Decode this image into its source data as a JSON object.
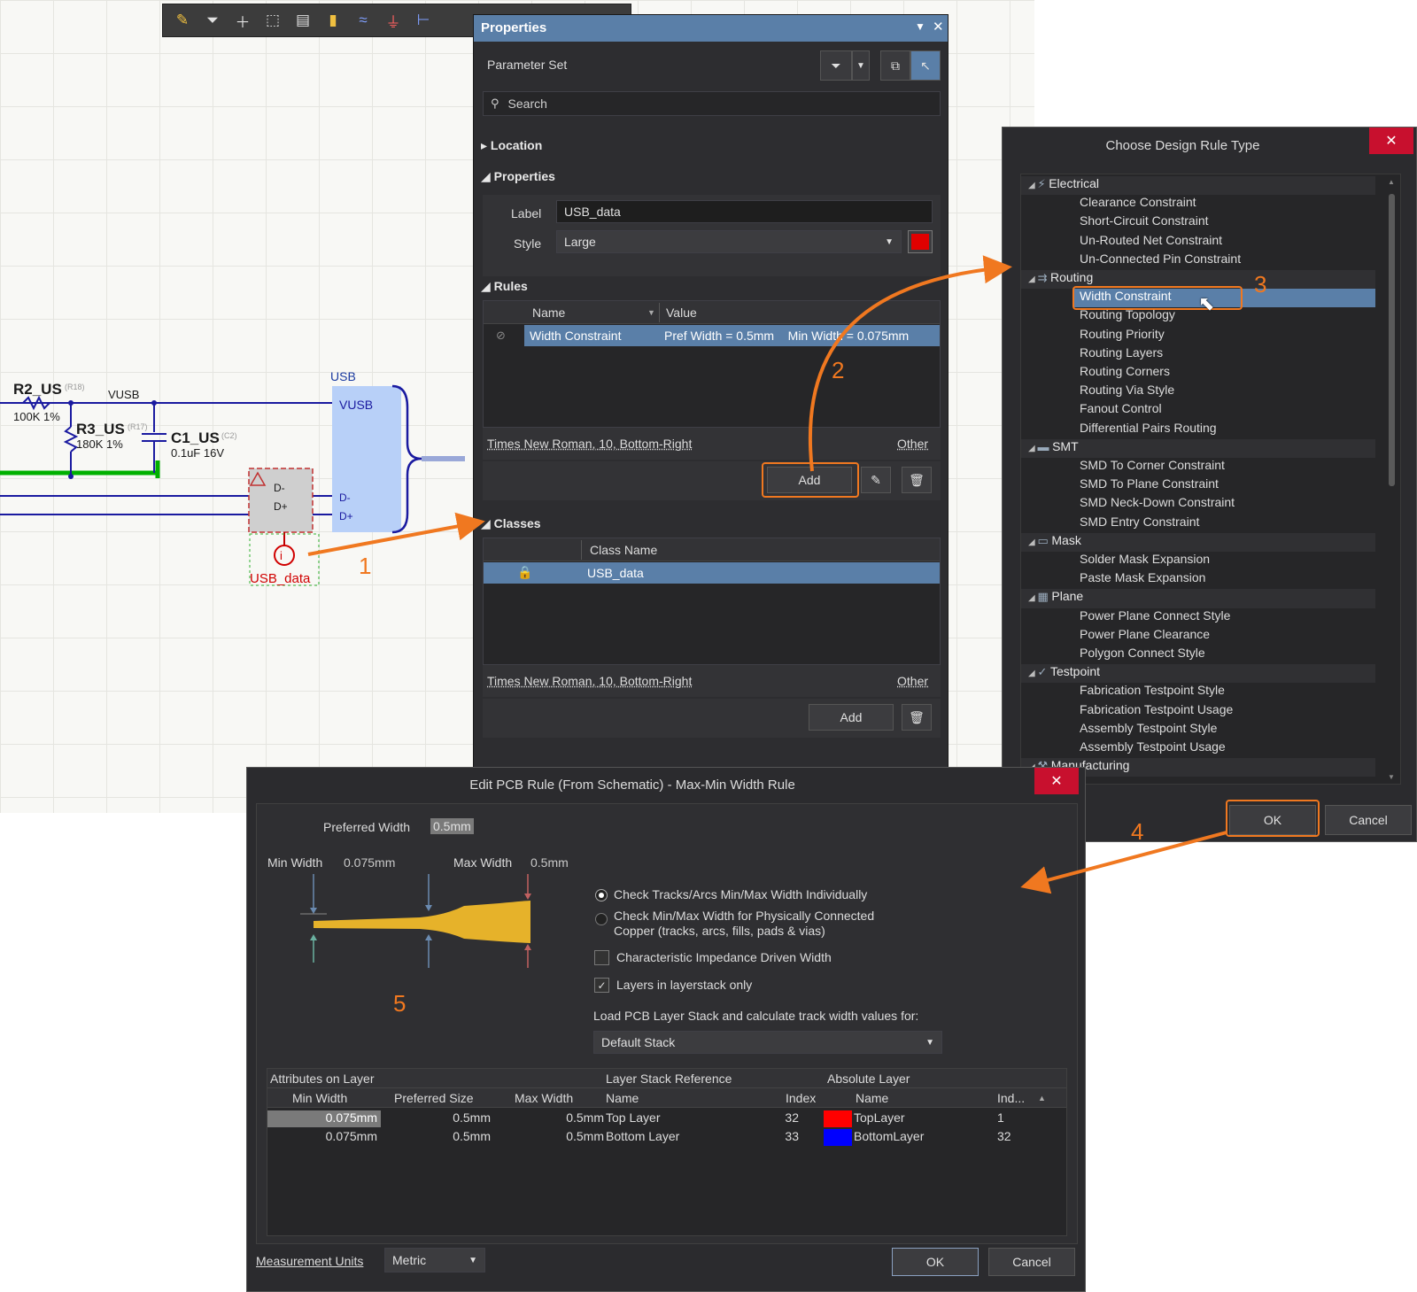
{
  "schematic": {
    "r2_name": "R2_US",
    "r2_ref": "(R18)",
    "r2_value": "100K 1%",
    "r3_name": "R3_US",
    "r3_ref": "(R17)",
    "r3_value": "180K 1%",
    "c1_name": "C1_US",
    "c1_ref": "(C2)",
    "c1_value": "0.1uF 16V",
    "net_vusb": "VUSB",
    "usb_title": "USB",
    "usb_pin_vusb": "VUSB",
    "usb_pin_dm": "D-",
    "usb_pin_dp": "D+",
    "conn_dm": "D-",
    "conn_dp": "D+",
    "directive_label": "USB_data"
  },
  "annotations": {
    "n1": "1",
    "n2": "2",
    "n3": "3",
    "n4": "4",
    "n5": "5"
  },
  "properties": {
    "title": "Properties",
    "parameter_set": "Parameter Set",
    "search_placeholder": "Search",
    "sec_location": "Location",
    "sec_properties": "Properties",
    "label_caption": "Label",
    "label_value": "USB_data",
    "style_caption": "Style",
    "style_value": "Large",
    "style_color": "#e00000",
    "sec_rules": "Rules",
    "rules_col_name": "Name",
    "rules_col_value": "Value",
    "rule_name": "Width Constraint",
    "rule_value": "Pref Width = 0.5mm    Min Width = 0.075mm",
    "font_info_rules": "Times New Roman, 10, Bottom-Right",
    "other_rules": "Other",
    "add_rules": "Add",
    "sec_classes": "Classes",
    "classes_col": "Class Name",
    "class_row": "USB_data",
    "font_info_classes": "Times New Roman, 10, Bottom-Right",
    "other_classes": "Other",
    "add_classes": "Add"
  },
  "choose_dialog": {
    "title": "Choose Design Rule Type",
    "categories": [
      {
        "name": "Electrical",
        "items": [
          "Clearance Constraint",
          "Short-Circuit Constraint",
          "Un-Routed Net Constraint",
          "Un-Connected Pin Constraint"
        ]
      },
      {
        "name": "Routing",
        "items": [
          "Width Constraint",
          "Routing Topology",
          "Routing Priority",
          "Routing Layers",
          "Routing Corners",
          "Routing Via Style",
          "Fanout Control",
          "Differential Pairs Routing"
        ]
      },
      {
        "name": "SMT",
        "items": [
          "SMD To Corner Constraint",
          "SMD To Plane Constraint",
          "SMD Neck-Down Constraint",
          "SMD Entry Constraint"
        ]
      },
      {
        "name": "Mask",
        "items": [
          "Solder Mask Expansion",
          "Paste Mask Expansion"
        ]
      },
      {
        "name": "Plane",
        "items": [
          "Power Plane Connect Style",
          "Power Plane Clearance",
          "Polygon Connect Style"
        ]
      },
      {
        "name": "Testpoint",
        "items": [
          "Fabrication Testpoint Style",
          "Fabrication Testpoint Usage",
          "Assembly Testpoint Style",
          "Assembly Testpoint Usage"
        ]
      },
      {
        "name": "Manufacturing",
        "items": []
      }
    ],
    "ok": "OK",
    "cancel": "Cancel"
  },
  "edit_dialog": {
    "title": "Edit PCB Rule (From Schematic) - Max-Min Width Rule",
    "preferred_width_label": "Preferred Width",
    "preferred_width_value": "0.5mm",
    "min_width_label": "Min Width",
    "min_width_value": "0.075mm",
    "max_width_label": "Max Width",
    "max_width_value": "0.5mm",
    "radio1": "Check Tracks/Arcs Min/Max Width Individually",
    "radio2_line1": "Check Min/Max Width for Physically Connected",
    "radio2_line2": "Copper (tracks, arcs, fills, pads & vias)",
    "check1": "Characteristic Impedance Driven Width",
    "check2": "Layers in layerstack only",
    "load_label": "Load PCB Layer Stack and calculate track width values for:",
    "stack_value": "Default Stack",
    "grp_attr": "Attributes on Layer",
    "grp_ref": "Layer Stack Reference",
    "grp_abs": "Absolute Layer",
    "col_min": "Min Width",
    "col_pref": "Preferred Size",
    "col_max": "Max Width",
    "col_name": "Name",
    "col_index": "Index",
    "col_absname": "Name",
    "col_ind": "Ind...",
    "rows": [
      {
        "min": "0.075mm",
        "pref": "0.5mm",
        "max": "0.5mm",
        "name": "Top Layer",
        "index": "32",
        "color": "#ff0000",
        "absname": "TopLayer",
        "ind": "1"
      },
      {
        "min": "0.075mm",
        "pref": "0.5mm",
        "max": "0.5mm",
        "name": "Bottom Layer",
        "index": "33",
        "color": "#0000ff",
        "absname": "BottomLayer",
        "ind": "32"
      }
    ],
    "units_label": "Measurement Units",
    "units_value": "Metric",
    "ok": "OK",
    "cancel": "Cancel"
  }
}
